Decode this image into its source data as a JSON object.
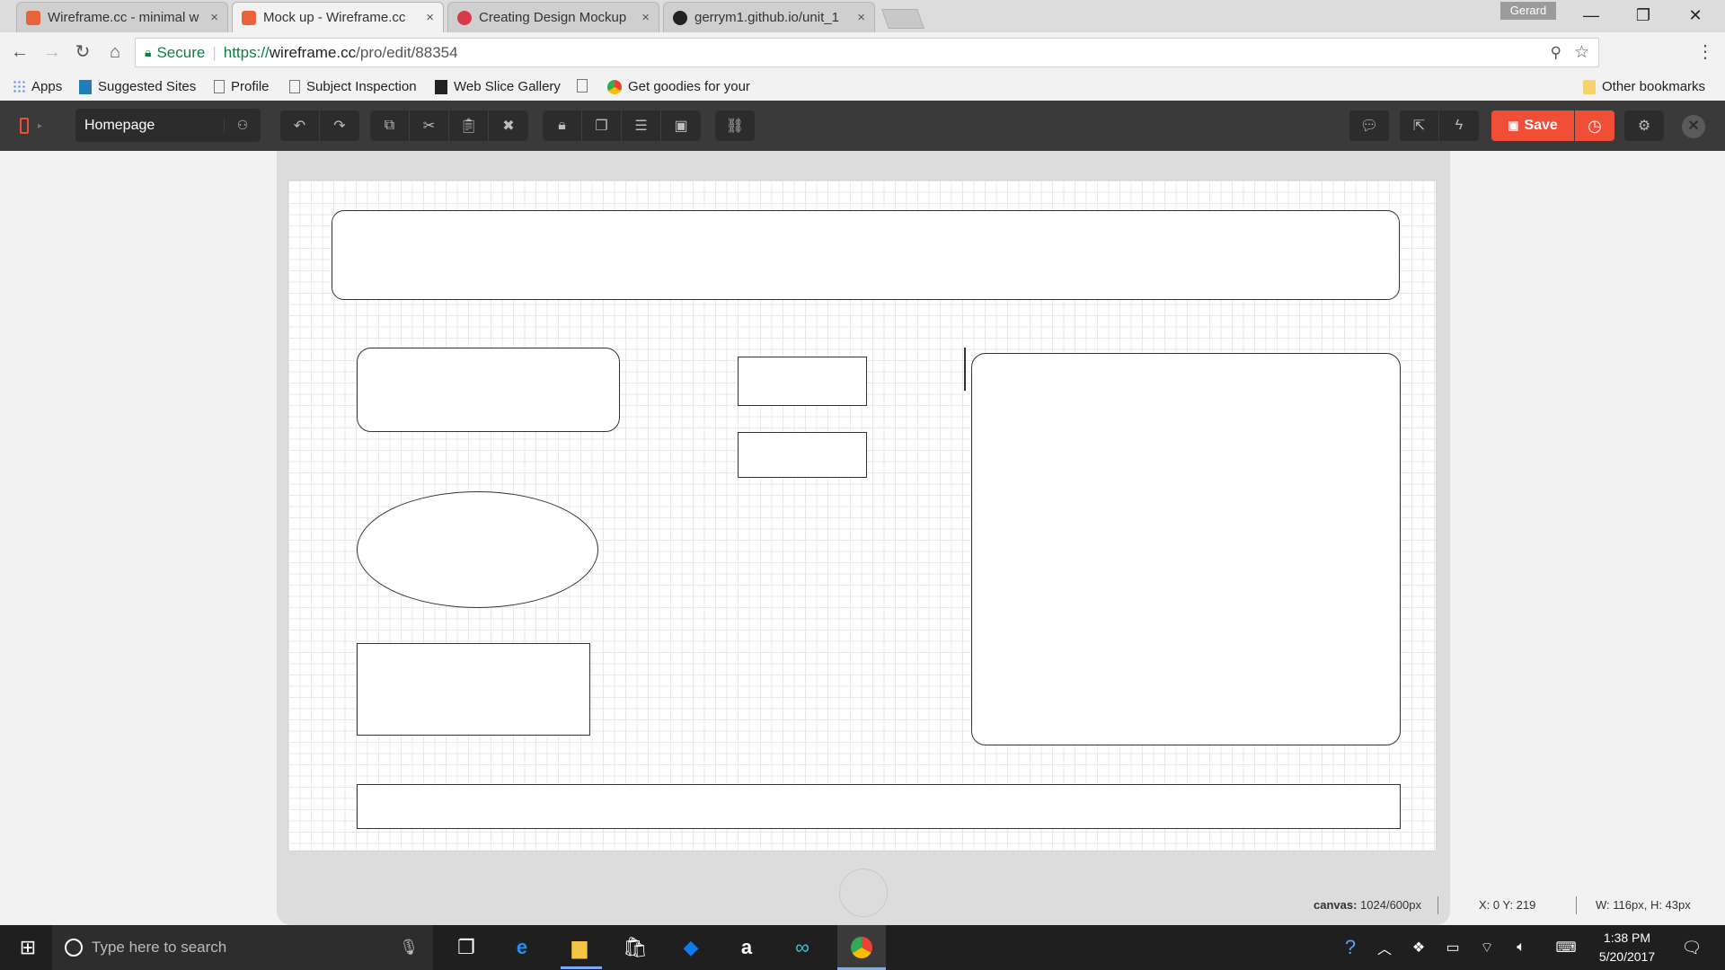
{
  "browser": {
    "tabs": [
      {
        "title": "Wireframe.cc - minimal w",
        "favicon_color": "#e8633a",
        "active": false
      },
      {
        "title": "Mock up - Wireframe.cc",
        "favicon_color": "#e8633a",
        "active": true
      },
      {
        "title": "Creating Design Mockup",
        "favicon_color": "#d93a4a",
        "active": false
      },
      {
        "title": "gerrym1.github.io/unit_1",
        "favicon_color": "#222222",
        "active": false
      }
    ],
    "tab_close_glyph": "×",
    "profile_name": "Gerard",
    "window_buttons": {
      "minimize": "—",
      "restore": "❐",
      "close": "✕"
    },
    "address": {
      "secure_label": "Secure",
      "url_scheme": "https://",
      "url_host": "wireframe.cc",
      "url_path": "/pro/edit/88354"
    },
    "bookmarks": [
      "Apps",
      "Suggested Sites",
      "Profile",
      "Subject Inspection",
      "Web Slice Gallery",
      "Get goodies for your ",
      "Other bookmarks"
    ]
  },
  "app": {
    "page_name": "Homepage",
    "save_label": "Save",
    "accent_color": "#f04e37",
    "toolbar_icons": [
      "undo-icon",
      "redo-icon",
      "copy-icon",
      "cut-icon",
      "paste-icon",
      "delete-icon",
      "lock-icon",
      "arrange-icon",
      "align-icon",
      "group-icon",
      "link-icon",
      "comment-icon",
      "export-icon",
      "flash-icon",
      "history-icon",
      "settings-icon",
      "close-icon"
    ]
  },
  "status": {
    "canvas_label": "canvas:",
    "canvas_value": "1024/600px",
    "position": "X: 0 Y: 219",
    "size": "W: 116px, H: 43px"
  },
  "taskbar": {
    "search_placeholder": "Type here to search",
    "time": "1:38 PM",
    "date": "5/20/2017"
  }
}
